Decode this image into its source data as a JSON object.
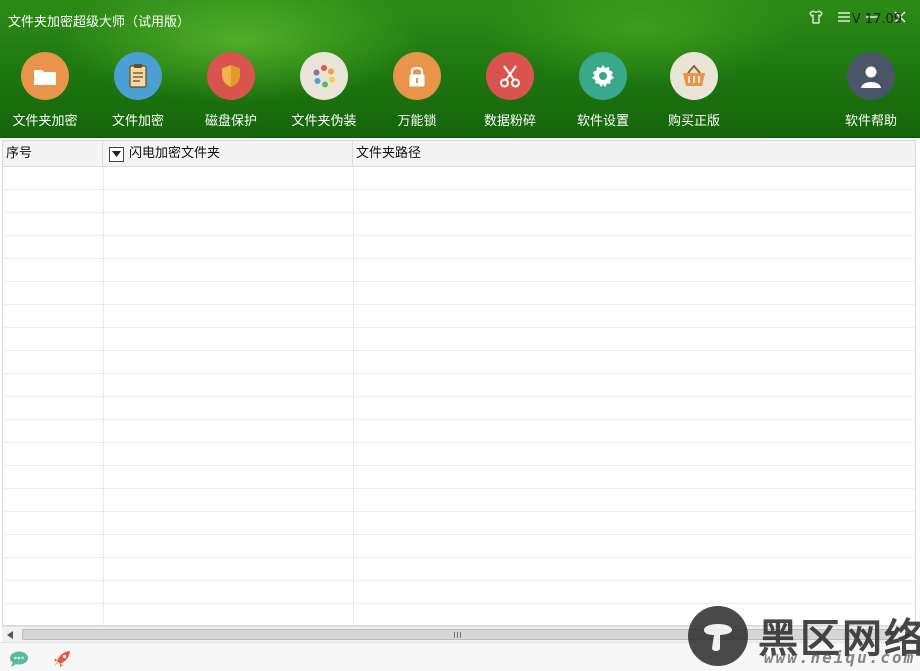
{
  "window": {
    "title": "文件夹加密超级大师（试用版）",
    "controls": [
      {
        "icon": "shirt-icon"
      },
      {
        "icon": "menu-icon"
      },
      {
        "icon": "minimize-icon"
      },
      {
        "icon": "close-icon"
      }
    ]
  },
  "toolbar": {
    "items": [
      {
        "label": "文件夹加密",
        "icon": "folder-icon",
        "color": "#e8944a"
      },
      {
        "label": "文件加密",
        "icon": "clipboard-icon",
        "color": "#4a9fd4"
      },
      {
        "label": "磁盘保护",
        "icon": "shield-icon",
        "color": "#d9534f"
      },
      {
        "label": "文件夹伪装",
        "icon": "color-wheel-icon",
        "color": "#e9e4d6"
      },
      {
        "label": "万能锁",
        "icon": "lock-icon",
        "color": "#e8944a"
      },
      {
        "label": "数据粉碎",
        "icon": "scissors-icon",
        "color": "#d9534f"
      },
      {
        "label": "软件设置",
        "icon": "gear-icon",
        "color": "#3aa98b"
      },
      {
        "label": "购买正版",
        "icon": "basket-icon",
        "color": "#e9e4d6"
      },
      {
        "label": "软件帮助",
        "icon": "user-icon",
        "color": "#4a5568"
      }
    ]
  },
  "table": {
    "columns": [
      "序号",
      "闪电加密文件夹",
      "文件夹路径"
    ],
    "rows": []
  },
  "statusbar": {
    "version": "V 17.09",
    "icons": [
      "chat-icon",
      "rocket-icon"
    ]
  },
  "watermark": {
    "text": "黑区网络",
    "url": "www.heiqu.com"
  }
}
